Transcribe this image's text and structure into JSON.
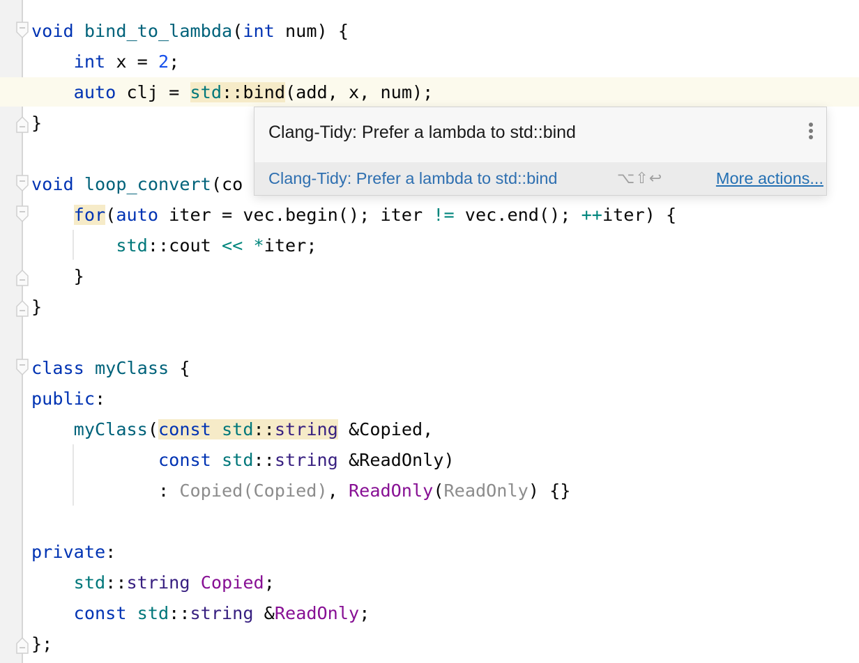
{
  "editor": {
    "lines": {
      "l1": {
        "kw_void": "void",
        "fn": "bind_to_lambda",
        "p1": "(",
        "kw_int": "int",
        "rest": " num) {"
      },
      "l2": {
        "kw_int": "int",
        "mid": " x = ",
        "num": "2",
        "end": ";"
      },
      "l3": {
        "kw_auto": "auto",
        "mid": " clj = ",
        "ns": "std",
        "sep": "::",
        "fn": "bind",
        "rest": "(add, x, num);"
      },
      "l4": {
        "text": "}"
      },
      "l6": {
        "kw_void": "void",
        "fn": "loop_convert",
        "rest": "(co"
      },
      "l7": {
        "kw_for": "for",
        "p": "(",
        "kw_auto": "auto",
        "a": " iter = vec.begin(); iter ",
        "op1": "!=",
        "b": " vec.end(); ",
        "op2": "++",
        "c": "iter) {"
      },
      "l8": {
        "ns": "std",
        "a": "::cout ",
        "op": "<<",
        "b": " ",
        "op2": "*",
        "c": "iter;"
      },
      "l9": {
        "text": "}"
      },
      "l10": {
        "text": "}"
      },
      "l12": {
        "kw_class": "class",
        "name": "myClass",
        "rest": " {"
      },
      "l13": {
        "kw": "public",
        "rest": ":"
      },
      "l14": {
        "fn": "myClass",
        "p": "(",
        "kw_const": "const",
        "ns": "std",
        "sep": "::",
        "ty": "string",
        "rest": " &Copied,"
      },
      "l15": {
        "kw_const": "const",
        "ns": "std",
        "sep": "::",
        "ty": "string",
        "rest": " &ReadOnly)"
      },
      "l16": {
        "colon": ": ",
        "d1": "Copied(Copied)",
        "comma": ", ",
        "mem": "ReadOnly",
        "p": "(",
        "d2": "ReadOnly",
        "rest": ") {}"
      },
      "l18": {
        "kw": "private",
        "rest": ":"
      },
      "l19": {
        "ns": "std",
        "sep": "::",
        "ty": "string",
        "mem": "Copied",
        "rest": ";"
      },
      "l20": {
        "kw_const": "const",
        "ns": "std",
        "sep": "::",
        "ty": "string",
        "amp": " &",
        "mem": "ReadOnly",
        "rest": ";"
      },
      "l21": {
        "text": "};"
      }
    }
  },
  "popup": {
    "title": "Clang-Tidy: Prefer a lambda to std::bind",
    "menu_icon": "kebab-menu-icon",
    "fix_label": "Clang-Tidy: Prefer a lambda to std::bind",
    "shortcut": "⌥⇧↩",
    "more_actions": "More actions..."
  }
}
